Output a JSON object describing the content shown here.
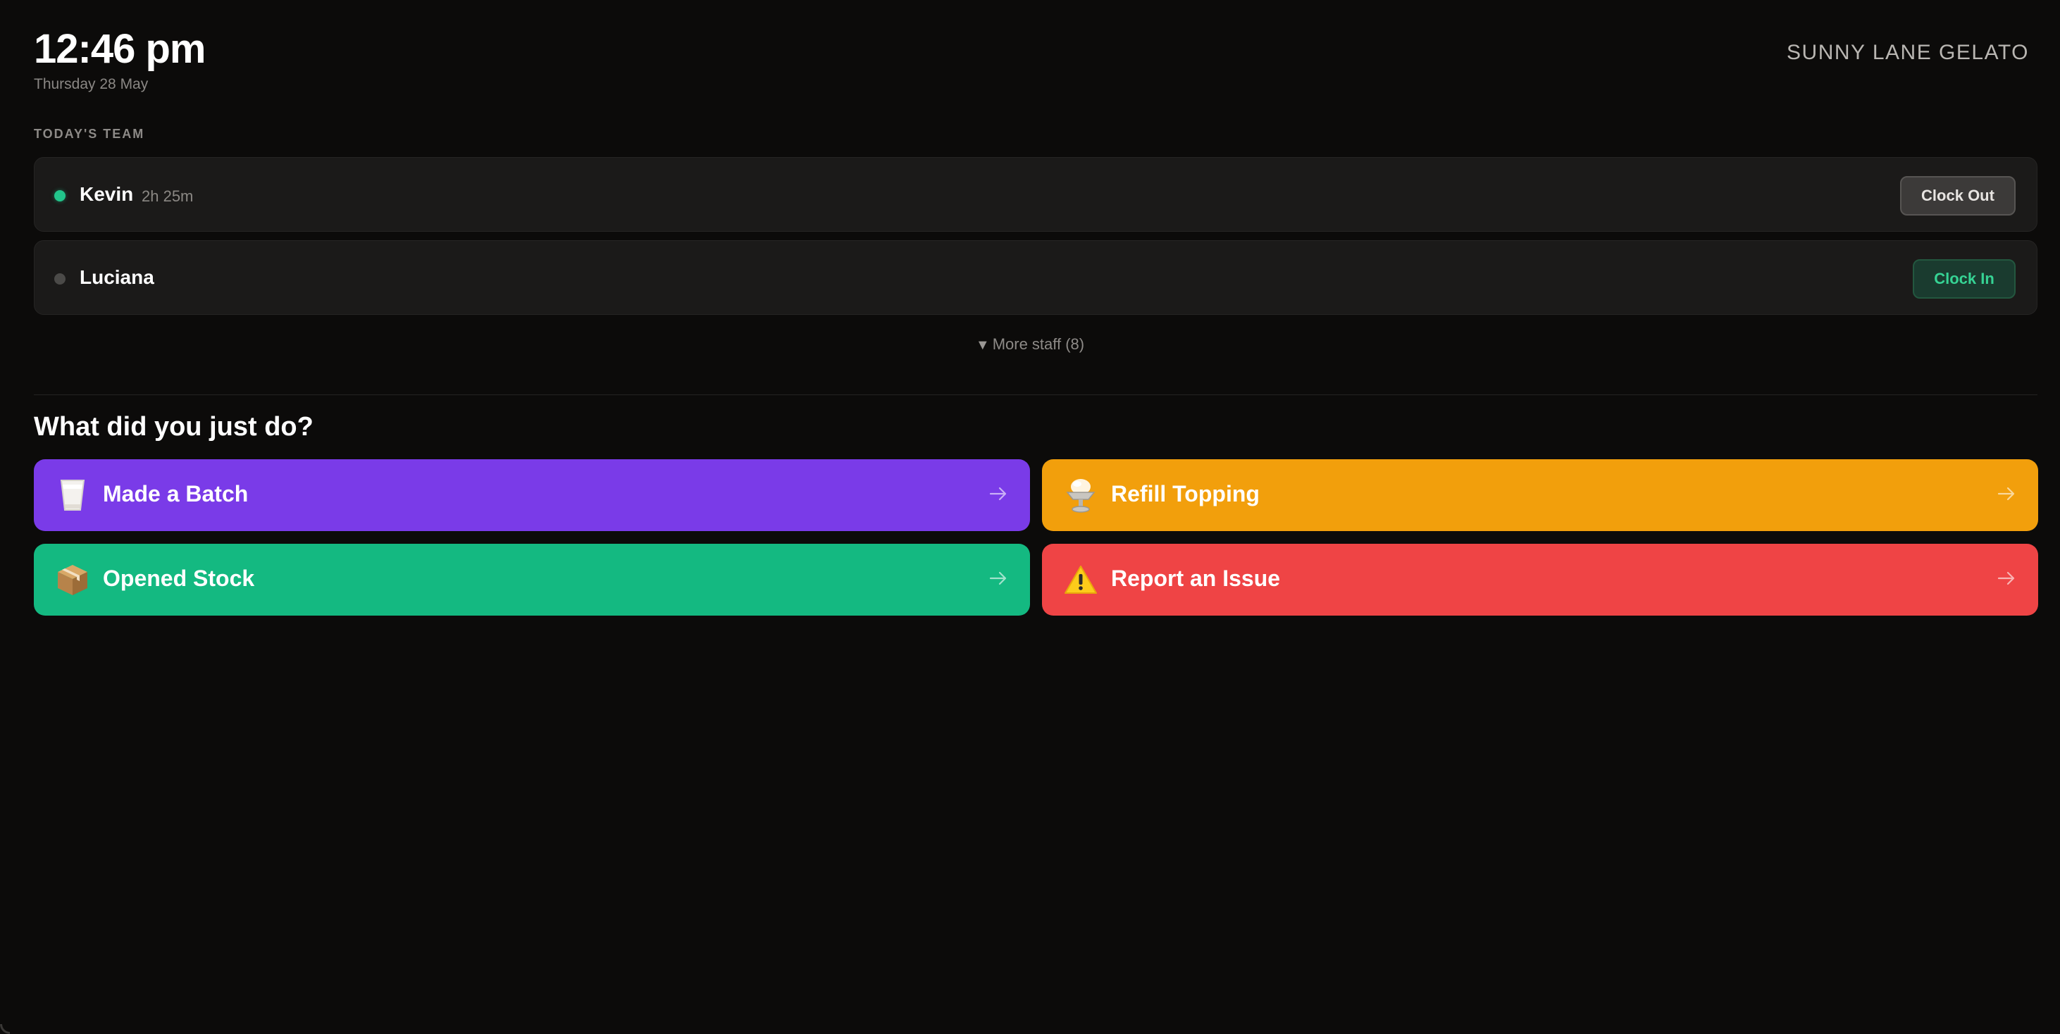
{
  "header": {
    "time": "12:46 pm",
    "date": "Thursday 28 May",
    "brand": "SUNNY LANE GELATO"
  },
  "team": {
    "section_label": "TODAY'S TEAM",
    "staff": [
      {
        "name": "Kevin",
        "duration": "2h 25m",
        "status": "clocked-in",
        "action_label": "Clock Out"
      },
      {
        "name": "Luciana",
        "duration": "",
        "status": "clocked-out",
        "action_label": "Clock In"
      }
    ],
    "more_staff_label": "More staff (8)"
  },
  "actions": {
    "question": "What did you just do?",
    "items": [
      {
        "label": "Made a Batch",
        "icon": "milk-glass-icon",
        "color": "#7a3be8"
      },
      {
        "label": "Refill Topping",
        "icon": "sundae-cup-icon",
        "color": "#f29f0c"
      },
      {
        "label": "Opened Stock",
        "icon": "package-box-icon",
        "color": "#14b981"
      },
      {
        "label": "Report an Issue",
        "icon": "warning-icon",
        "color": "#ef4445"
      }
    ]
  },
  "colors": {
    "background": "#0c0b0a",
    "active_dot": "#22c58b",
    "inactive_dot": "#4b4a48",
    "clock_in_text": "#36d394"
  }
}
